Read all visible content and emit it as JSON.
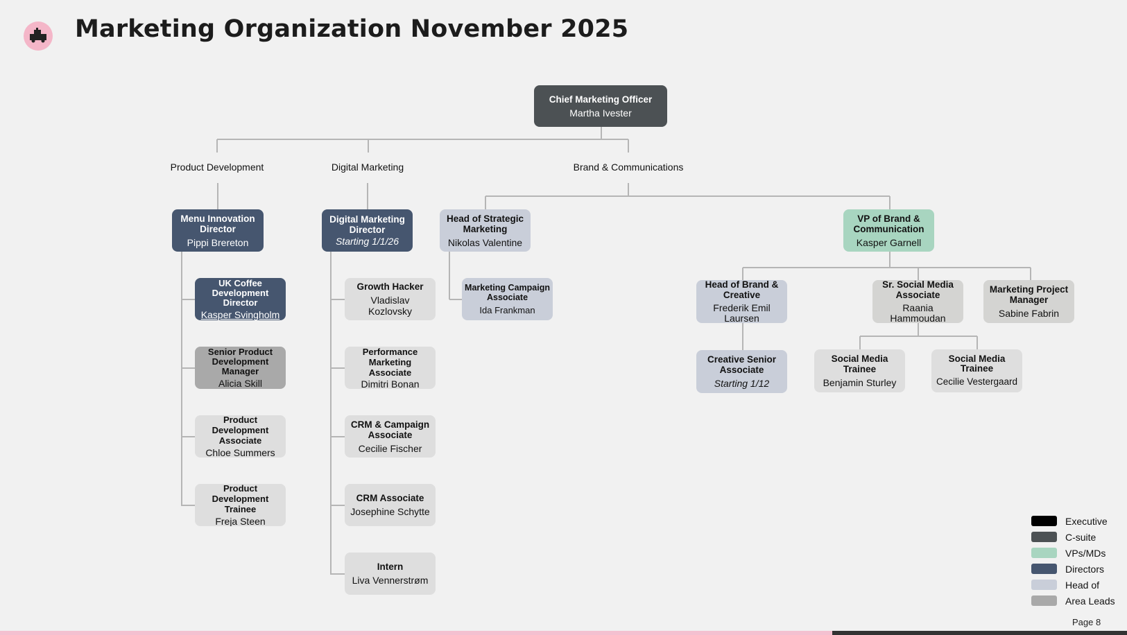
{
  "page": {
    "title": "Marketing Organization November 2025",
    "page_number": "Page 8"
  },
  "departments": {
    "product_development": "Product Development",
    "digital_marketing": "Digital Marketing",
    "brand_communications": "Brand & Communications"
  },
  "nodes": {
    "cmo": {
      "role": "Chief Marketing Officer",
      "person": "Martha Ivester"
    },
    "menu_innovation": {
      "role": "Menu Innovation Director",
      "person": "Pippi Brereton"
    },
    "uk_coffee": {
      "role": "UK Coffee Development Director",
      "person": "Kasper Svingholm"
    },
    "senior_pdm": {
      "role": "Senior Product Development Manager",
      "person": "Alicia Skill"
    },
    "pd_associate": {
      "role": "Product Development Associate",
      "person": "Chloe Summers"
    },
    "pd_trainee": {
      "role": "Product Development Trainee",
      "person": "Freja Steen"
    },
    "digital_director": {
      "role": "Digital Marketing Director",
      "person": "Starting 1/1/26"
    },
    "growth_hacker": {
      "role": "Growth Hacker",
      "person": "Vladislav Kozlovsky"
    },
    "performance": {
      "role": "Performance Marketing Associate",
      "person": "Dimitri Bonan"
    },
    "crm_campaign": {
      "role": "CRM & Campaign Associate",
      "person": "Cecilie Fischer"
    },
    "crm_associate": {
      "role": "CRM Associate",
      "person": "Josephine Schytte"
    },
    "intern": {
      "role": "Intern",
      "person": "Liva Vennerstrøm"
    },
    "head_strategic": {
      "role": "Head of Strategic Marketing",
      "person": "Nikolas Valentine"
    },
    "mkt_campaign": {
      "role": "Marketing Campaign Associate",
      "person": "Ida Frankman"
    },
    "vp_brand": {
      "role": "VP of Brand & Communication",
      "person": "Kasper Garnell"
    },
    "head_brand": {
      "role": "Head of Brand & Creative",
      "person": "Frederik Emil Laursen"
    },
    "creative_senior": {
      "role": "Creative Senior Associate",
      "person": "Starting 1/12"
    },
    "sr_social": {
      "role": "Sr. Social Media Associate",
      "person": "Raania Hammoudan"
    },
    "social_trainee_1": {
      "role": "Social Media Trainee",
      "person": "Benjamin Sturley"
    },
    "social_trainee_2": {
      "role": "Social Media Trainee",
      "person": "Cecilie Vestergaard"
    },
    "mkt_pm": {
      "role": "Marketing Project Manager",
      "person": "Sabine Fabrin"
    }
  },
  "legend": [
    {
      "label": "Executive",
      "color": "#000000"
    },
    {
      "label": "C-suite",
      "color": "#4c5154"
    },
    {
      "label": "VPs/MDs",
      "color": "#a8d5c0"
    },
    {
      "label": "Directors",
      "color": "#46566f"
    },
    {
      "label": "Head of",
      "color": "#c9ced9"
    },
    {
      "label": "Area Leads",
      "color": "#a9a9a9"
    }
  ]
}
